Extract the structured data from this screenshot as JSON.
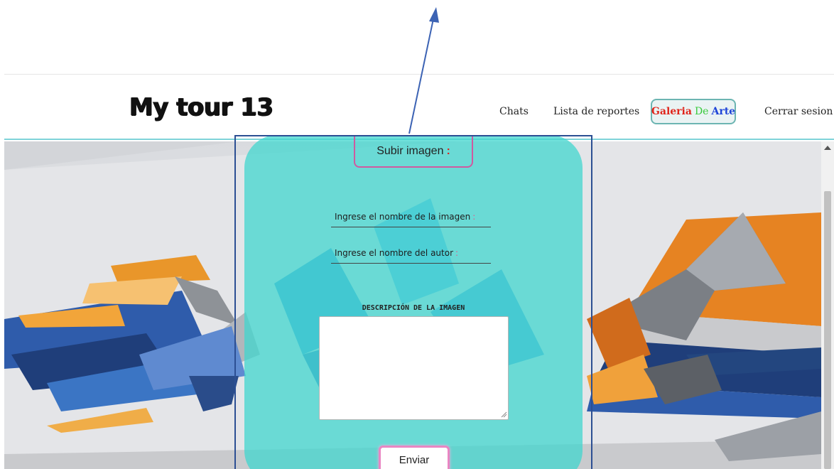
{
  "app": {
    "logo": "My tour 13"
  },
  "nav": {
    "chats": "Chats",
    "reportes": "Lista de reportes",
    "galeria_1": "Galeria",
    "galeria_2": "De",
    "galeria_3": "Arte",
    "cerrar": "Cerrar sesion"
  },
  "form": {
    "title": "Subir imagen",
    "title_colon": ":",
    "nombre_label": "Ingrese el nombre de la imagen",
    "autor_label": "Ingrese el nombre del autor",
    "label_colon": ":",
    "descripcion_label": "DESCRIPCIÓN DE LA IMAGEN",
    "descripcion_value": "",
    "submit": "Enviar"
  },
  "colors": {
    "panel": "#40d6ce",
    "galeria_red": "#e0241b",
    "galeria_green": "#37c93a",
    "galeria_blue": "#1e44d8",
    "annotation": "#2c4f93",
    "button_border": "#e986c3"
  }
}
